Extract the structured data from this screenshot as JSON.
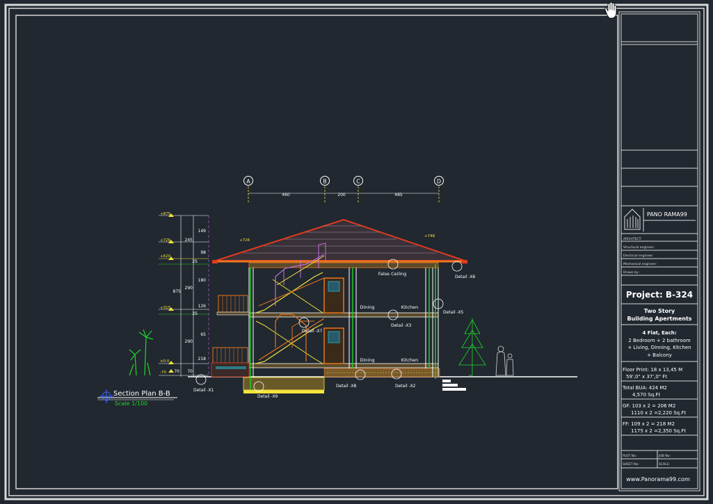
{
  "drawing": {
    "grid_labels": [
      "A",
      "B",
      "C",
      "D"
    ],
    "grid_dims": [
      "460",
      "200",
      "485"
    ],
    "levels": [
      "+875",
      "+726",
      "+620",
      "+315",
      "±0.0",
      "-70",
      "+748",
      "+726"
    ],
    "vertical_dims": [
      "149",
      "245",
      "98",
      "25",
      "180",
      "290",
      "126",
      "25",
      "65",
      "290",
      "218",
      "70",
      "70",
      "875"
    ],
    "room_labels": [
      "False Ceiling",
      "Dining",
      "Kitchen",
      "Dining",
      "Kitchen"
    ],
    "details": [
      "Detail -X1",
      "Detail -X2",
      "Detail -X3",
      "Detail -X5",
      "Detail -X6",
      "Detail -X7",
      "Detail -X8",
      "Detail -X9"
    ],
    "section_title": "Section Plan B-B",
    "scale": "Scale  1/100"
  },
  "title_block": {
    "brand": "PANO RAMA99",
    "fields": [
      "ARCHITECT:",
      "Structural engineer:",
      "Electrical engineer:",
      "Mechanical engineer:",
      "Drawn by :"
    ],
    "project": "Project: B-324",
    "building_line1": "Two Story",
    "building_line2": "Building Apertments",
    "flats_title": "4 Flat, Each:",
    "flats_line1": "2 Bedroom + 2 bathroom",
    "flats_line2": "+ Living, Dinning, Kitchen",
    "flats_line3": "+  Balcony",
    "footprint_line1": "Floor Print:  18 x 13,45 M",
    "footprint_line2": "59',0\" x 37',0\" Ft",
    "bua_line1": "Total BUA: 424    M2",
    "bua_line2": "4,570 Sq.Ft",
    "gf_line1": "GF:  103 x 2 = 206    M2",
    "gf_line2": "1110 x 2 =2,220  Sq.Ft",
    "ff_line1": "FF:  109 x 2 = 218    M2",
    "ff_line2": "1175 x 2 =2,350  Sq.Ft",
    "plot_no": "PLOT No:",
    "job_no": "JOB No:",
    "sheet_no": "SHEET No:",
    "scale_label": "SCALE:",
    "website": "www.Panorama99.com"
  },
  "colors": {
    "background": "#212830",
    "frame": "#d8d8d8",
    "green": "#22d62a",
    "orange": "#e8741e",
    "red": "#e23a1e",
    "yellow": "#f4e43a",
    "magenta": "#c46ce0",
    "cyan": "#21b4c8",
    "white": "#ffffff"
  }
}
